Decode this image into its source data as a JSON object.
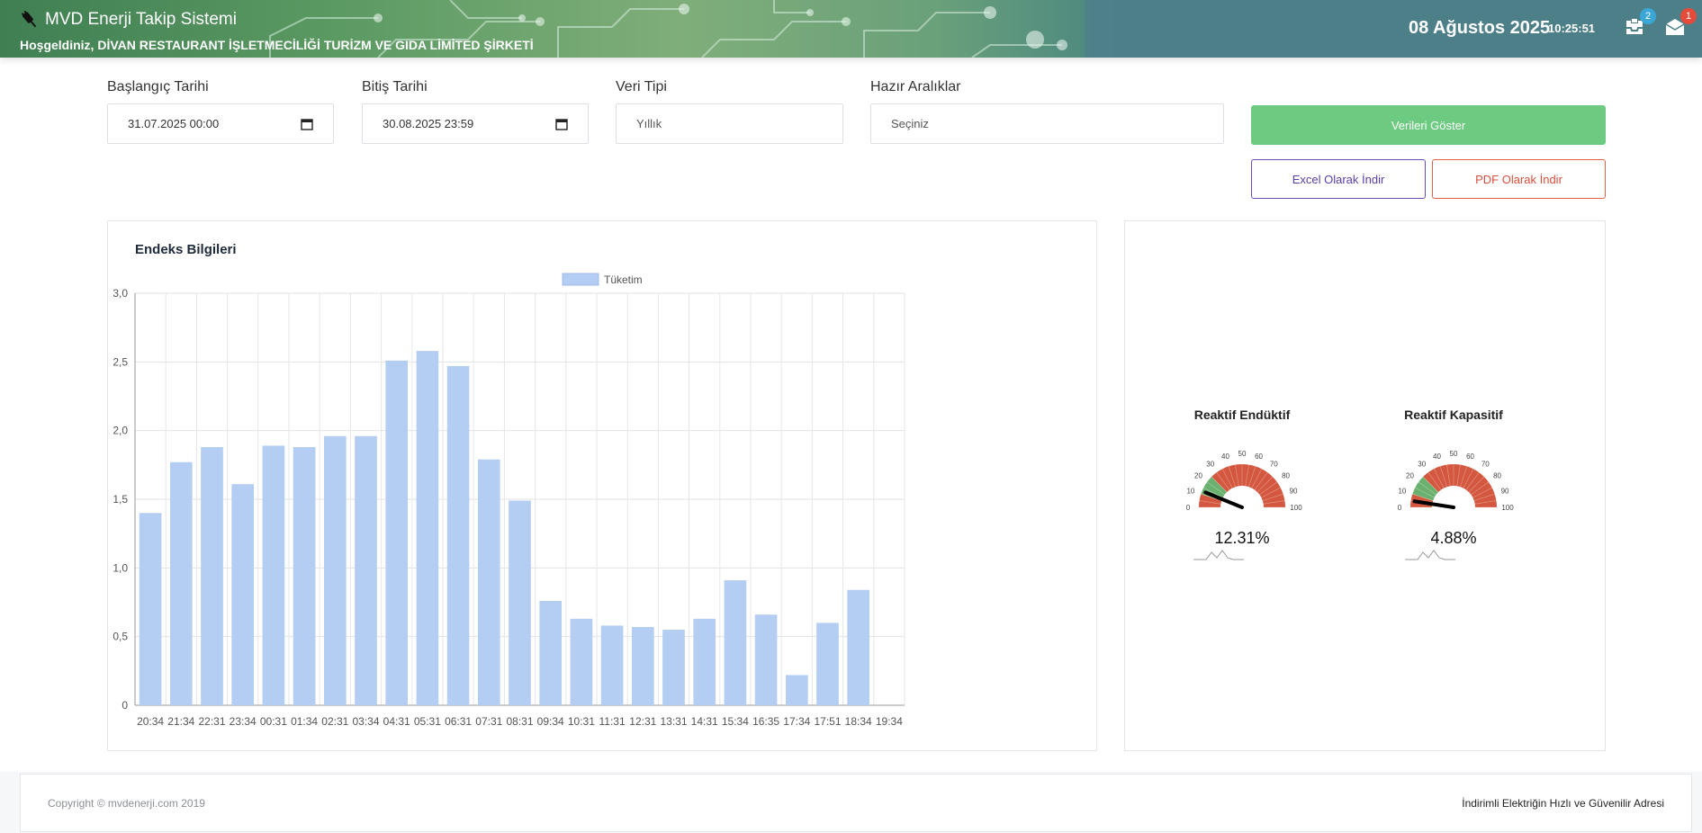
{
  "header": {
    "app_title": "MVD Enerji Takip Sistemi",
    "welcome": "Hoşgeldiniz, DİVAN RESTAURANT İŞLETMECİLİĞİ TURİZM VE GIDA LİMİTED ŞİRKETİ",
    "date": "08 Ağustos 2025",
    "time": "10:25:51",
    "inbox_badge": "2",
    "mail_badge": "1",
    "logo_icon": "plug-icon"
  },
  "filters": {
    "start_label": "Başlangıç Tarihi",
    "start_value": "31.07.2025 00:00",
    "end_label": "Bitiş Tarihi",
    "end_value": "30.08.2025 23:59",
    "type_label": "Veri Tipi",
    "type_value": "Yıllık",
    "range_label": "Hazır Aralıklar",
    "range_value": "Seçiniz"
  },
  "buttons": {
    "show": "Verileri Göster",
    "excel": "Excel Olarak İndir",
    "pdf": "PDF Olarak İndir"
  },
  "chart_panel": {
    "title": "Endeks Bilgileri"
  },
  "chart_data": {
    "type": "bar",
    "title": "",
    "xlabel": "",
    "ylabel": "",
    "ylim": [
      0,
      3
    ],
    "yticks": [
      "0",
      "0,5",
      "1,0",
      "1,5",
      "2,0",
      "2,5",
      "3,0"
    ],
    "legend_position": "top",
    "grid": true,
    "color": "#b3cdf3",
    "categories": [
      "20:34",
      "21:34",
      "22:31",
      "23:34",
      "00:31",
      "01:34",
      "02:31",
      "03:34",
      "04:31",
      "05:31",
      "06:31",
      "07:31",
      "08:31",
      "09:34",
      "10:31",
      "11:31",
      "12:31",
      "13:31",
      "14:31",
      "15:34",
      "16:35",
      "17:34",
      "17:51",
      "18:34",
      "19:34"
    ],
    "series": [
      {
        "name": "Tüketim",
        "values": [
          1.4,
          1.77,
          1.88,
          1.61,
          1.89,
          1.88,
          1.96,
          1.96,
          2.51,
          2.58,
          2.47,
          1.79,
          1.49,
          0.76,
          0.63,
          0.58,
          0.57,
          0.55,
          0.63,
          0.91,
          0.66,
          0.22,
          0.6,
          0.84,
          0
        ]
      }
    ]
  },
  "gauges": [
    {
      "title": "Reaktif Endüktif",
      "value_label": "12.31%",
      "value": 12.31,
      "ticks": [
        "0",
        "10",
        "20",
        "30",
        "40",
        "50",
        "60",
        "70",
        "80",
        "90",
        "100"
      ]
    },
    {
      "title": "Reaktif Kapasitif",
      "value_label": "4.88%",
      "value": 4.88,
      "ticks": [
        "0",
        "10",
        "20",
        "30",
        "40",
        "50",
        "60",
        "70",
        "80",
        "90",
        "100"
      ]
    }
  ],
  "gauge_colors": {
    "ok": "#6ab06e",
    "bad": "#d4573f",
    "needle": "#000000"
  },
  "footer": {
    "copyright": "Copyright © mvdenerji.com 2019",
    "slogan": "İndirimli Elektriğin Hızlı ve Güvenilir Adresi"
  }
}
